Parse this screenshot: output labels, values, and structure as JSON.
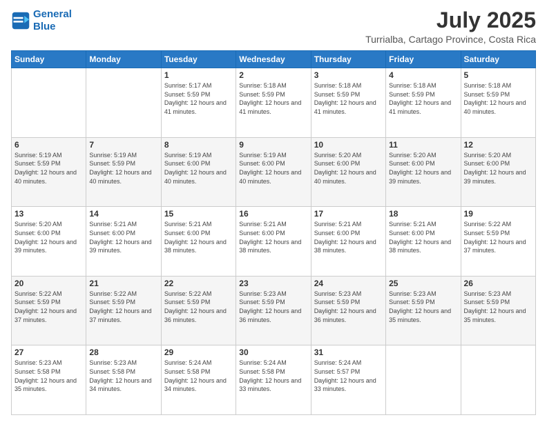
{
  "header": {
    "logo_line1": "General",
    "logo_line2": "Blue",
    "main_title": "July 2025",
    "subtitle": "Turrialba, Cartago Province, Costa Rica"
  },
  "calendar": {
    "days_of_week": [
      "Sunday",
      "Monday",
      "Tuesday",
      "Wednesday",
      "Thursday",
      "Friday",
      "Saturday"
    ],
    "weeks": [
      [
        {
          "day": "",
          "info": ""
        },
        {
          "day": "",
          "info": ""
        },
        {
          "day": "1",
          "info": "Sunrise: 5:17 AM\nSunset: 5:59 PM\nDaylight: 12 hours and 41 minutes."
        },
        {
          "day": "2",
          "info": "Sunrise: 5:18 AM\nSunset: 5:59 PM\nDaylight: 12 hours and 41 minutes."
        },
        {
          "day": "3",
          "info": "Sunrise: 5:18 AM\nSunset: 5:59 PM\nDaylight: 12 hours and 41 minutes."
        },
        {
          "day": "4",
          "info": "Sunrise: 5:18 AM\nSunset: 5:59 PM\nDaylight: 12 hours and 41 minutes."
        },
        {
          "day": "5",
          "info": "Sunrise: 5:18 AM\nSunset: 5:59 PM\nDaylight: 12 hours and 40 minutes."
        }
      ],
      [
        {
          "day": "6",
          "info": "Sunrise: 5:19 AM\nSunset: 5:59 PM\nDaylight: 12 hours and 40 minutes."
        },
        {
          "day": "7",
          "info": "Sunrise: 5:19 AM\nSunset: 5:59 PM\nDaylight: 12 hours and 40 minutes."
        },
        {
          "day": "8",
          "info": "Sunrise: 5:19 AM\nSunset: 6:00 PM\nDaylight: 12 hours and 40 minutes."
        },
        {
          "day": "9",
          "info": "Sunrise: 5:19 AM\nSunset: 6:00 PM\nDaylight: 12 hours and 40 minutes."
        },
        {
          "day": "10",
          "info": "Sunrise: 5:20 AM\nSunset: 6:00 PM\nDaylight: 12 hours and 40 minutes."
        },
        {
          "day": "11",
          "info": "Sunrise: 5:20 AM\nSunset: 6:00 PM\nDaylight: 12 hours and 39 minutes."
        },
        {
          "day": "12",
          "info": "Sunrise: 5:20 AM\nSunset: 6:00 PM\nDaylight: 12 hours and 39 minutes."
        }
      ],
      [
        {
          "day": "13",
          "info": "Sunrise: 5:20 AM\nSunset: 6:00 PM\nDaylight: 12 hours and 39 minutes."
        },
        {
          "day": "14",
          "info": "Sunrise: 5:21 AM\nSunset: 6:00 PM\nDaylight: 12 hours and 39 minutes."
        },
        {
          "day": "15",
          "info": "Sunrise: 5:21 AM\nSunset: 6:00 PM\nDaylight: 12 hours and 38 minutes."
        },
        {
          "day": "16",
          "info": "Sunrise: 5:21 AM\nSunset: 6:00 PM\nDaylight: 12 hours and 38 minutes."
        },
        {
          "day": "17",
          "info": "Sunrise: 5:21 AM\nSunset: 6:00 PM\nDaylight: 12 hours and 38 minutes."
        },
        {
          "day": "18",
          "info": "Sunrise: 5:21 AM\nSunset: 6:00 PM\nDaylight: 12 hours and 38 minutes."
        },
        {
          "day": "19",
          "info": "Sunrise: 5:22 AM\nSunset: 5:59 PM\nDaylight: 12 hours and 37 minutes."
        }
      ],
      [
        {
          "day": "20",
          "info": "Sunrise: 5:22 AM\nSunset: 5:59 PM\nDaylight: 12 hours and 37 minutes."
        },
        {
          "day": "21",
          "info": "Sunrise: 5:22 AM\nSunset: 5:59 PM\nDaylight: 12 hours and 37 minutes."
        },
        {
          "day": "22",
          "info": "Sunrise: 5:22 AM\nSunset: 5:59 PM\nDaylight: 12 hours and 36 minutes."
        },
        {
          "day": "23",
          "info": "Sunrise: 5:23 AM\nSunset: 5:59 PM\nDaylight: 12 hours and 36 minutes."
        },
        {
          "day": "24",
          "info": "Sunrise: 5:23 AM\nSunset: 5:59 PM\nDaylight: 12 hours and 36 minutes."
        },
        {
          "day": "25",
          "info": "Sunrise: 5:23 AM\nSunset: 5:59 PM\nDaylight: 12 hours and 35 minutes."
        },
        {
          "day": "26",
          "info": "Sunrise: 5:23 AM\nSunset: 5:59 PM\nDaylight: 12 hours and 35 minutes."
        }
      ],
      [
        {
          "day": "27",
          "info": "Sunrise: 5:23 AM\nSunset: 5:58 PM\nDaylight: 12 hours and 35 minutes."
        },
        {
          "day": "28",
          "info": "Sunrise: 5:23 AM\nSunset: 5:58 PM\nDaylight: 12 hours and 34 minutes."
        },
        {
          "day": "29",
          "info": "Sunrise: 5:24 AM\nSunset: 5:58 PM\nDaylight: 12 hours and 34 minutes."
        },
        {
          "day": "30",
          "info": "Sunrise: 5:24 AM\nSunset: 5:58 PM\nDaylight: 12 hours and 33 minutes."
        },
        {
          "day": "31",
          "info": "Sunrise: 5:24 AM\nSunset: 5:57 PM\nDaylight: 12 hours and 33 minutes."
        },
        {
          "day": "",
          "info": ""
        },
        {
          "day": "",
          "info": ""
        }
      ]
    ]
  }
}
